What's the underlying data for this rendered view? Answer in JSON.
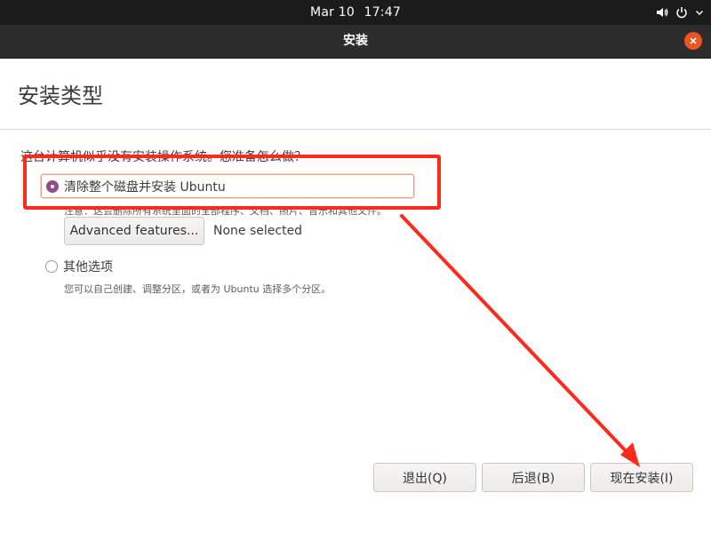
{
  "topbar": {
    "date": "Mar 10",
    "time": "17:47",
    "icons": [
      "volume-icon",
      "power-icon",
      "chevron-down-icon"
    ]
  },
  "window": {
    "title": "安装",
    "close_icon": "close-icon"
  },
  "page": {
    "title": "安装类型",
    "question": "这台计算机似乎没有安装操作系统。您准备怎么做？"
  },
  "options": {
    "erase": {
      "label": "清除整个磁盘并安装 Ubuntu",
      "selected": true,
      "note": "注意：这会删除所有系统里面的全部程序、文档、照片、音乐和其他文件。"
    },
    "advanced": {
      "button_label": "Advanced features...",
      "status": "None selected"
    },
    "other": {
      "label": "其他选项",
      "selected": false,
      "note": "您可以自己创建、调整分区，或者为 Ubuntu 选择多个分区。"
    }
  },
  "buttons": {
    "quit": "退出(Q)",
    "back": "后退(B)",
    "install": "现在安装(I)"
  },
  "colors": {
    "accent": "#e95420",
    "radio": "#924d8b",
    "annotation": "#ff2a1a"
  }
}
